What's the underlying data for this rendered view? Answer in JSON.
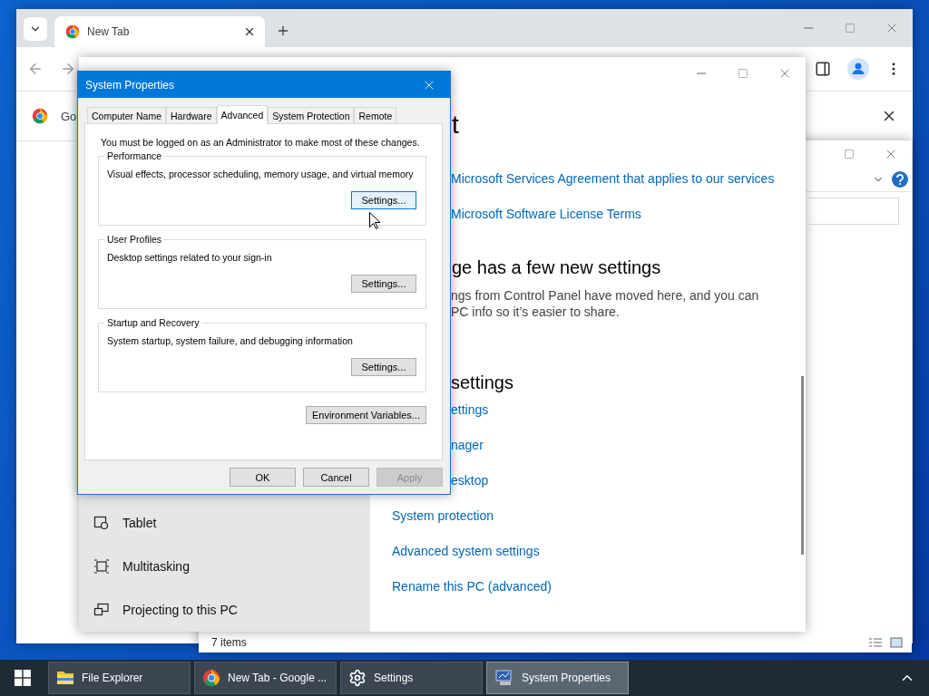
{
  "browser": {
    "tabs": [
      {
        "label": "New Tab",
        "selected": true
      }
    ],
    "infobar": {
      "text": "Go"
    }
  },
  "explorer": {
    "status": "7 items"
  },
  "settings": {
    "heading": "t",
    "agreement_links": [
      "Microsoft Services Agreement that applies to our services",
      "Microsoft Software License Terms"
    ],
    "section_heading": "ge has a few new settings",
    "section_lines": [
      "ngs from Control Panel have moved here, and you can",
      "PC info so it’s easier to share."
    ],
    "related_heading": "settings",
    "related_links_covered": [
      "ettings",
      "nager",
      "esktop"
    ],
    "related_links": [
      "System protection",
      "Advanced system settings",
      "Rename this PC (advanced)"
    ],
    "nav": [
      {
        "label": "Tablet",
        "kind": "tablet"
      },
      {
        "label": "Multitasking",
        "kind": "multitasking"
      },
      {
        "label": "Projecting to this PC",
        "kind": "projecting"
      }
    ]
  },
  "dialog": {
    "title": "System Properties",
    "tabs": [
      {
        "label": "Computer Name",
        "selected": false
      },
      {
        "label": "Hardware",
        "selected": false
      },
      {
        "label": "Advanced",
        "selected": true
      },
      {
        "label": "System Protection",
        "selected": false
      },
      {
        "label": "Remote",
        "selected": false
      }
    ],
    "notice": "You must be logged on as an Administrator to make most of these changes.",
    "groups": [
      {
        "title": "Performance",
        "description": "Visual effects, processor scheduling, memory usage, and virtual memory",
        "button": "Settings...",
        "hovered": true
      },
      {
        "title": "User Profiles",
        "description": "Desktop settings related to your sign-in",
        "button": "Settings...",
        "hovered": false
      },
      {
        "title": "Startup and Recovery",
        "description": "System startup, system failure, and debugging information",
        "button": "Settings...",
        "hovered": false
      }
    ],
    "env_button": "Environment Variables...",
    "buttons": [
      {
        "label": "OK",
        "disabled": false
      },
      {
        "label": "Cancel",
        "disabled": false
      },
      {
        "label": "Apply",
        "disabled": true
      }
    ]
  },
  "taskbar": {
    "items": [
      {
        "label": "File Explorer",
        "kind": "folder",
        "active": false
      },
      {
        "label": "New Tab - Google ...",
        "kind": "chrome",
        "active": false
      },
      {
        "label": "Settings",
        "kind": "gear",
        "active": false
      },
      {
        "label": "System Properties",
        "kind": "monitor",
        "active": true
      }
    ]
  }
}
